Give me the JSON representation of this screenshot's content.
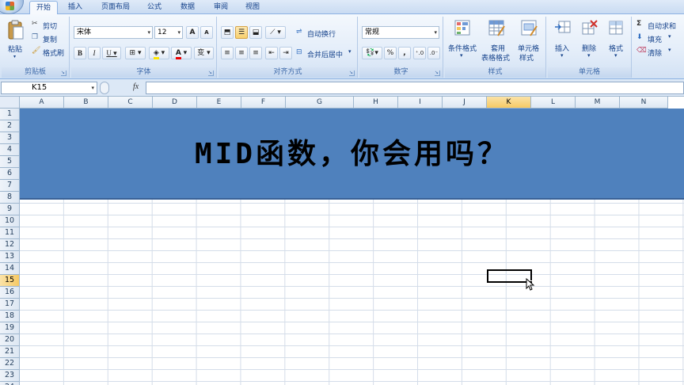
{
  "tabs": [
    "开始",
    "插入",
    "页面布局",
    "公式",
    "数据",
    "审阅",
    "视图"
  ],
  "clipboard": {
    "paste": "粘贴",
    "cut": "剪切",
    "copy": "复制",
    "format_painter": "格式刷",
    "group": "剪贴板"
  },
  "font": {
    "name": "宋体",
    "size": "12",
    "bold": "B",
    "italic": "I",
    "underline": "U",
    "grow": "A",
    "shrink": "A",
    "group": "字体",
    "special": "变"
  },
  "alignment": {
    "wrap": "自动换行",
    "merge": "合并后居中",
    "group": "对齐方式"
  },
  "number": {
    "format": "常规",
    "percent": "%",
    "comma": ",",
    "group": "数字"
  },
  "styles": {
    "conditional_line1": "条件格式",
    "table_line1": "套用",
    "table_line2": "表格格式",
    "cell_line1": "单元格",
    "cell_line2": "样式",
    "group": "样式"
  },
  "cells": {
    "insert": "插入",
    "delete": "删除",
    "format": "格式",
    "group": "单元格"
  },
  "editing": {
    "autosum": "自动求和",
    "fill": "填充",
    "clear": "清除",
    "sigma": "Σ"
  },
  "formula_bar": {
    "name_box": "K15",
    "fx": "fx",
    "formula": ""
  },
  "sheet": {
    "columns": [
      "A",
      "B",
      "C",
      "D",
      "E",
      "F",
      "G",
      "H",
      "I",
      "J",
      "K",
      "L",
      "M",
      "N"
    ],
    "rows": [
      "1",
      "2",
      "3",
      "4",
      "5",
      "6",
      "7",
      "8",
      "9",
      "10",
      "11",
      "12",
      "13",
      "14",
      "15",
      "16",
      "17",
      "18",
      "19",
      "20",
      "21",
      "22",
      "23",
      "24"
    ],
    "selected_column": "K",
    "selected_row": "15",
    "title": "MID函数，你会用吗？"
  },
  "colors": {
    "title_band": "#4f81bd",
    "accent_select": "#f6c964",
    "ribbon_text": "#15428b"
  }
}
